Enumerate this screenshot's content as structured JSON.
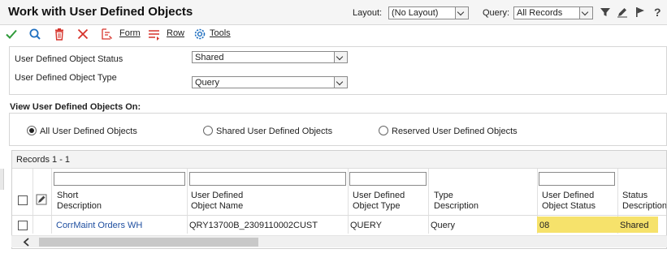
{
  "header": {
    "title": "Work with User Defined Objects",
    "layout_label": "Layout:",
    "layout_value": "(No Layout)",
    "query_label": "Query:",
    "query_value": "All Records",
    "help_glyph": "?"
  },
  "toolbar": {
    "form_label": "Form",
    "row_label": "Row",
    "tools_label": "Tools"
  },
  "filters": {
    "status_label": "User Defined Object Status",
    "status_value": "Shared",
    "type_label": "User Defined Object Type",
    "type_value": "Query"
  },
  "view": {
    "heading": "View User Defined Objects On:",
    "options": [
      {
        "label": "All User Defined Objects",
        "selected": true
      },
      {
        "label": "Shared User Defined Objects",
        "selected": false
      },
      {
        "label": "Reserved User Defined Objects",
        "selected": false
      }
    ]
  },
  "grid": {
    "records_label": "Records 1 - 1",
    "columns": [
      {
        "line1": "Short",
        "line2": "Description"
      },
      {
        "line1": "User Defined",
        "line2": "Object Name"
      },
      {
        "line1": "User Defined",
        "line2": "Object Type"
      },
      {
        "line1": "Type",
        "line2": "Description"
      },
      {
        "line1": "User Defined",
        "line2": "Object Status"
      },
      {
        "line1": "Status",
        "line2": "Description"
      }
    ],
    "rows": [
      {
        "short_description": "CorrMaint Orders WH",
        "object_name": "QRY13700B_2309110002CUST",
        "object_type": "QUERY",
        "type_description": "Query",
        "object_status": "08",
        "status_description": "Shared"
      }
    ]
  },
  "colors": {
    "accent_blue": "#1f4fa0",
    "check_green": "#2f9a3a",
    "close_red": "#d6332b",
    "highlight_yellow": "#f6e26b"
  },
  "icons": [
    "check-icon",
    "search-icon",
    "delete-icon",
    "close-icon",
    "form-icon",
    "row-icon",
    "tools-gear-icon",
    "filter-icon",
    "edit-icon",
    "flag-icon",
    "help-icon",
    "edit-grid-icon",
    "scroll-left-icon"
  ]
}
